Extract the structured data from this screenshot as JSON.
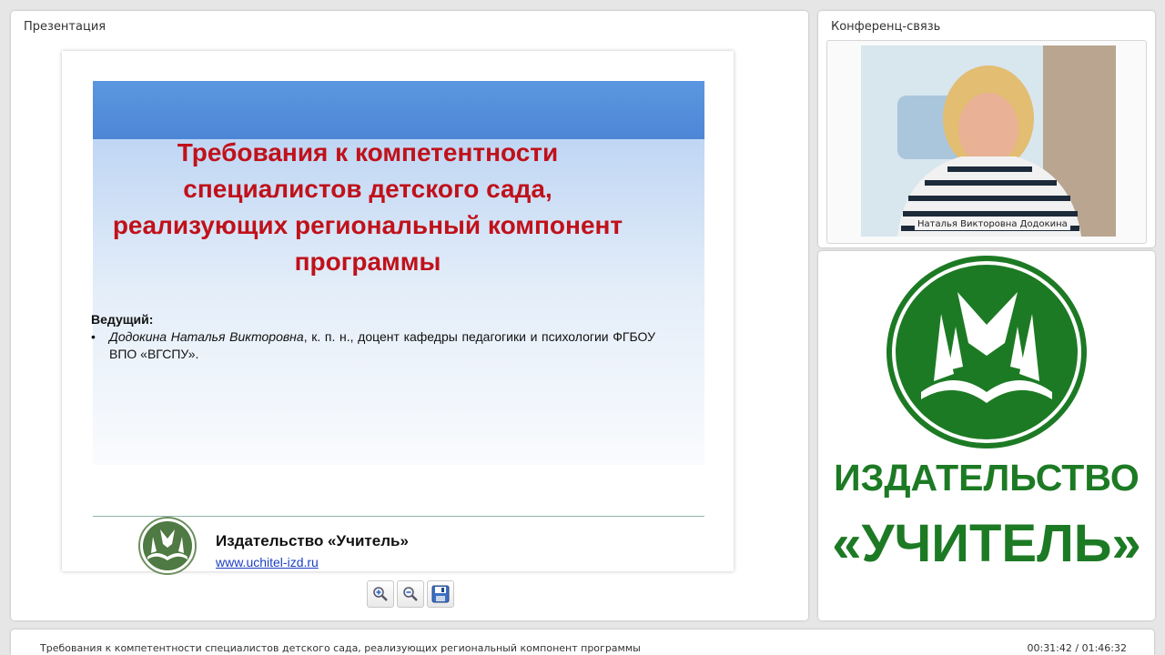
{
  "presentation_panel": {
    "title": "Презентация",
    "slide": {
      "title": "Требования к компетентности специалистов детского сада, реализующих региональный компонент программы",
      "presenter_label": "Ведущий:",
      "presenter_bullet": "•",
      "presenter_name": "Додокина Наталья Викторовна",
      "presenter_details": ", к. п. н., доцент кафедры педагогики и психологии ФГБОУ ВПО «ВГСПУ».",
      "publisher_name": "Издательство «Учитель»",
      "publisher_url": "www.uchitel-izd.ru"
    },
    "tools": [
      {
        "name": "zoom-in",
        "icon": "zoom-in-icon"
      },
      {
        "name": "zoom-out",
        "icon": "zoom-out-icon"
      },
      {
        "name": "save",
        "icon": "floppy-disk-icon"
      }
    ]
  },
  "conference_panel": {
    "title": "Конференц-связь",
    "participant_name": "Наталья Викторовна Додокина"
  },
  "logo_panel": {
    "line1": "ИЗДАТЕЛЬСТВО",
    "line2": "«УЧИТЕЛЬ»",
    "brand_color": "#1d7a24"
  },
  "status_bar": {
    "title": "Требования к компетентности специалистов детского сада, реализующих региональный компонент программы",
    "time": "00:31:42 / 01:46:32"
  }
}
